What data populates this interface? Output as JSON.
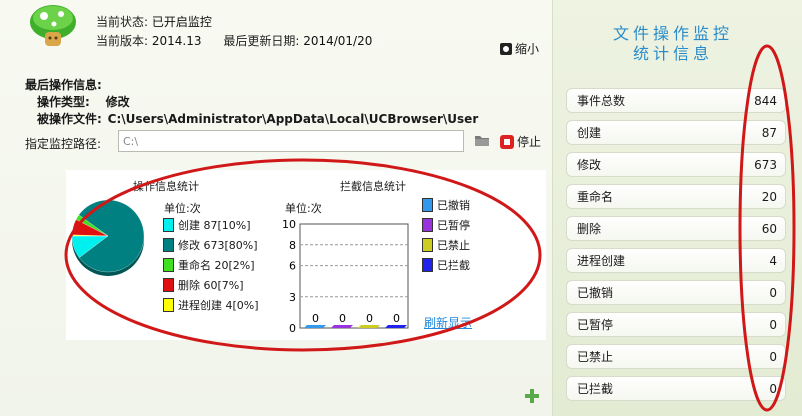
{
  "header": {
    "current_status_label": "当前状态:",
    "current_status_value": "已开启监控",
    "current_version_label": "当前版本:",
    "current_version_value": "2014.13",
    "last_update_label": "最后更新日期:",
    "last_update_value": "2014/01/20",
    "shrink_label": "缩小"
  },
  "last_op": {
    "title": "最后操作信息:",
    "type_label": "操作类型:",
    "type_value": "修改",
    "file_label": "被操作文件:",
    "file_value": "C:\\Users\\Administrator\\AppData\\Local\\UCBrowser\\User"
  },
  "monitor_path": {
    "label": "指定监控路径:",
    "value": "C:\\",
    "stop_label": "停止"
  },
  "op_stats": {
    "title": "操作信息统计",
    "unit": "单位:次",
    "legend": [
      {
        "label": "创建 87[10%]",
        "color": "#00f0f0"
      },
      {
        "label": "修改 673[80%]",
        "color": "#008080"
      },
      {
        "label": "重命名 20[2%]",
        "color": "#40e020"
      },
      {
        "label": "删除 60[7%]",
        "color": "#e01010"
      },
      {
        "label": "进程创建 4[0%]",
        "color": "#ffff00"
      }
    ]
  },
  "block_stats": {
    "title": "拦截信息统计",
    "unit": "单位:次",
    "y_ticks": [
      "10",
      "8",
      "6",
      "3",
      "0"
    ],
    "bar_values": [
      "0",
      "0",
      "0",
      "0"
    ],
    "legend": [
      {
        "label": "已撤销",
        "color": "#3399ee"
      },
      {
        "label": "已暂停",
        "color": "#9933dd"
      },
      {
        "label": "已禁止",
        "color": "#cccc22"
      },
      {
        "label": "已拦截",
        "color": "#2222ee"
      }
    ],
    "refresh_label": "刷新显示"
  },
  "right_panel": {
    "title_line1": "文件操作监控",
    "title_line2": "统计信息",
    "rows": [
      {
        "label": "事件总数",
        "value": "844"
      },
      {
        "label": "创建",
        "value": "87"
      },
      {
        "label": "修改",
        "value": "673"
      },
      {
        "label": "重命名",
        "value": "20"
      },
      {
        "label": "删除",
        "value": "60"
      },
      {
        "label": "进程创建",
        "value": "4"
      },
      {
        "label": "已撤销",
        "value": "0"
      },
      {
        "label": "已暂停",
        "value": "0"
      },
      {
        "label": "已禁止",
        "value": "0"
      },
      {
        "label": "已拦截",
        "value": "0"
      }
    ]
  },
  "chart_data": [
    {
      "type": "pie",
      "title": "操作信息统计",
      "categories": [
        "创建",
        "修改",
        "重命名",
        "删除",
        "进程创建"
      ],
      "values": [
        87,
        673,
        20,
        60,
        4
      ],
      "colors": [
        "#00f0f0",
        "#008080",
        "#40e020",
        "#e01010",
        "#ffff00"
      ]
    },
    {
      "type": "bar",
      "title": "拦截信息统计",
      "ylabel": "单位:次",
      "categories": [
        "已撤销",
        "已暂停",
        "已禁止",
        "已拦截"
      ],
      "values": [
        0,
        0,
        0,
        0
      ],
      "ylim": [
        0,
        10
      ],
      "colors": [
        "#3399ee",
        "#9933dd",
        "#cccc22",
        "#2222ee"
      ]
    }
  ]
}
